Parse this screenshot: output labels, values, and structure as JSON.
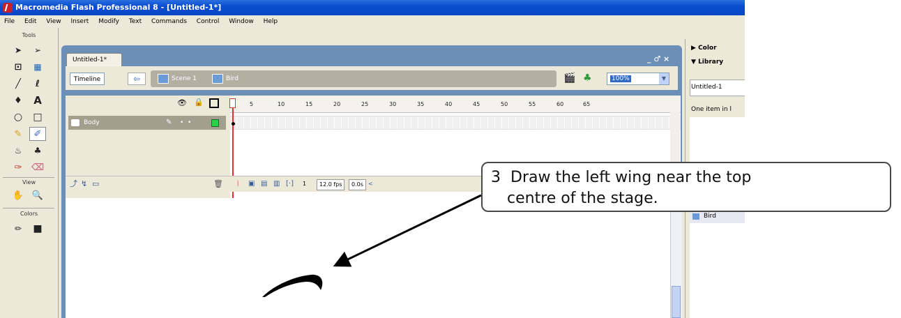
{
  "window": {
    "title": "Macromedia Flash Professional 8 - [Untitled-1*]"
  },
  "menu": [
    "File",
    "Edit",
    "View",
    "Insert",
    "Modify",
    "Text",
    "Commands",
    "Control",
    "Window",
    "Help"
  ],
  "tools": {
    "header": "Tools",
    "view_header": "View",
    "colors_header": "Colors"
  },
  "document": {
    "tab": "Untitled-1*",
    "timeline_button": "Timeline",
    "crumbs": {
      "scene": "Scene 1",
      "symbol": "Bird"
    },
    "zoom": "100%",
    "window_controls": "_ ♂ ×"
  },
  "timeline": {
    "layer_name": "Body",
    "ruler": [
      "1",
      "5",
      "10",
      "15",
      "20",
      "25",
      "30",
      "35",
      "40",
      "45",
      "50",
      "55",
      "60",
      "65"
    ],
    "frame": "1",
    "fps": "12.0 fps",
    "time": "0.0s"
  },
  "panels": {
    "color": "Color",
    "library": "Library",
    "library_doc": "Untitled-1",
    "library_count": "One item in l",
    "library_item": "Bird"
  },
  "callout": {
    "step": "3",
    "line1": "Draw the left wing near the top",
    "line2": "centre of the stage."
  }
}
